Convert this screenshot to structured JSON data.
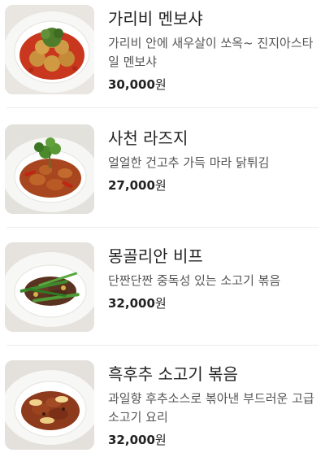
{
  "menu": {
    "items": [
      {
        "name": "가리비 멘보샤",
        "description": "가리비 안에 새우살이 쏘옥~ 진지아스타일 멘보샤",
        "price_amount": "30,000",
        "price_unit": "원",
        "image_icon": "dish-fried-shrimp-toast-icon"
      },
      {
        "name": "사천 라즈지",
        "description": "얼얼한 건고추 가득 마라 닭튀김",
        "price_amount": "27,000",
        "price_unit": "원",
        "image_icon": "dish-spicy-fried-chicken-icon"
      },
      {
        "name": "몽골리안 비프",
        "description": "단짠단짠 중독성 있는 소고기 볶음",
        "price_amount": "32,000",
        "price_unit": "원",
        "image_icon": "dish-beef-stirfry-icon"
      },
      {
        "name": "흑후추 소고기 볶음",
        "description": "과일향 후추소스로 볶아낸 부드러운 고급 소고기 요리",
        "price_amount": "32,000",
        "price_unit": "원",
        "image_icon": "dish-black-pepper-beef-icon"
      }
    ]
  },
  "colors": {
    "text_primary": "#222222",
    "text_secondary": "#555555",
    "divider": "#ececec"
  }
}
